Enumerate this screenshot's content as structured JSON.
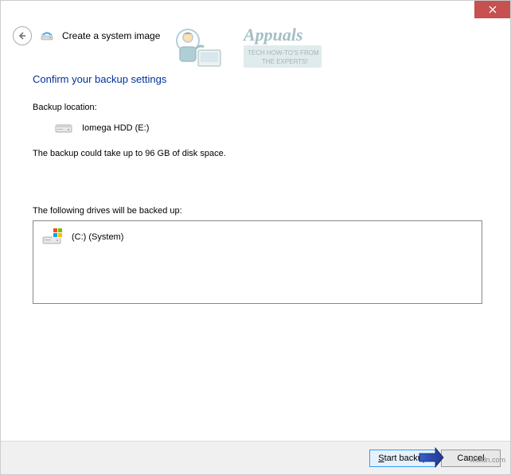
{
  "window": {
    "title": "Create a system image"
  },
  "heading": "Confirm your backup settings",
  "backup_location_label": "Backup location:",
  "backup_location_value": "Iomega HDD (E:)",
  "disk_space_text": "The backup could take up to 96 GB of disk space.",
  "drives_label": "The following drives will be backed up:",
  "drives": [
    {
      "name": "(C:) (System)"
    }
  ],
  "buttons": {
    "start_backup_prefix": "S",
    "start_backup_rest": "tart backup",
    "cancel": "Cancel"
  },
  "watermark": {
    "brand": "Appuals",
    "tag1": "TECH HOW-TO'S FROM",
    "tag2": "THE EXPERTS!"
  },
  "wsxdn": "wsxdn.com"
}
